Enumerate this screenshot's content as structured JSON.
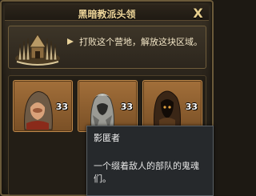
{
  "window": {
    "title": "黑暗教派头领",
    "close_label": "X"
  },
  "quest": {
    "description": "打败这个营地，解放这块区域。"
  },
  "units": [
    {
      "name": "hooded-cultist",
      "count": "33"
    },
    {
      "name": "shadow-hider",
      "count": "33"
    },
    {
      "name": "dark-priest",
      "count": "33"
    }
  ],
  "tooltip": {
    "name": "影匿者",
    "description": "一个缀着敌人的部队的鬼魂们。"
  },
  "colors": {
    "title_gold": "#f0d79a",
    "slot_bronze": "#a26f3a",
    "tooltip_bg": "#26292c"
  }
}
